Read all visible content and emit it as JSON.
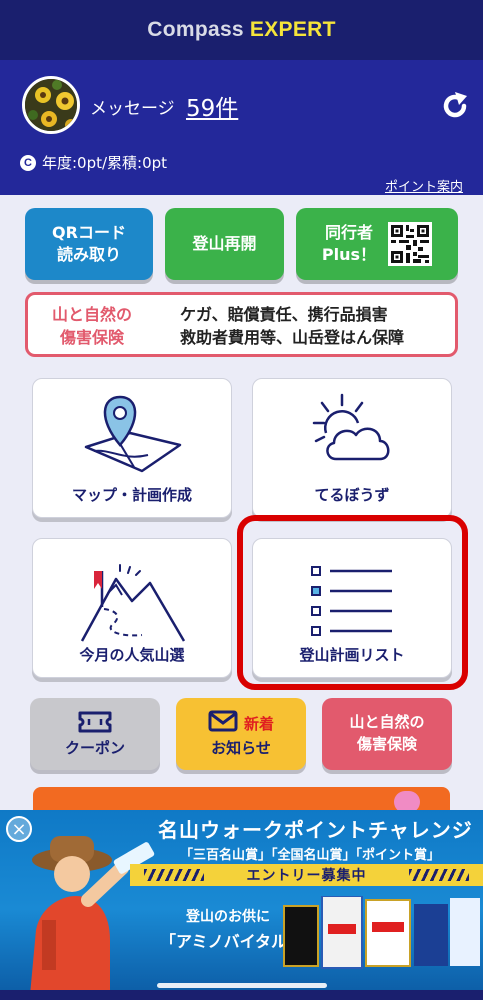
{
  "header": {
    "title_part1": "Compass",
    "title_part2": "EXPERT"
  },
  "profile": {
    "message_label": "メッセージ",
    "message_count": "59件",
    "points_text": "年度:0pt/累積:0pt",
    "points_icon_letter": "C",
    "point_guide_link": "ポイント案内"
  },
  "actions": {
    "qr_line1": "QRコード",
    "qr_line2": "読み取り",
    "resume": "登山再開",
    "companion_line1": "同行者",
    "companion_line2": "Plus！"
  },
  "insurance_banner": {
    "title_line1": "山と自然の",
    "title_line2": "傷害保険",
    "desc_line1": "ケガ、賠償責任、携行品損害",
    "desc_line2": "救助者費用等、山岳登はん保障"
  },
  "tiles": {
    "map": "マップ・計画作成",
    "weather": "てるぼうず",
    "popular": "今月の人気山選",
    "plan_list": "登山計画リスト"
  },
  "small_buttons": {
    "coupon": "クーポン",
    "news_new": "新着",
    "news": "お知らせ",
    "insurance_line1": "山と自然の",
    "insurance_line2": "傷害保険"
  },
  "ad": {
    "title": "名山ウォークポイントチャレンジ",
    "subtitle": "「三百名山賞」「全国名山賞」「ポイント賞」",
    "band": "エントリー募集中",
    "copy1": "登山のお供に",
    "copy2": "「アミノバイタル®」",
    "close": "×"
  },
  "colors": {
    "navy": "#1a1f6e",
    "profile_blue": "#23289a",
    "green": "#3bb24a",
    "blue": "#1d88c9",
    "red": "#e25a6d",
    "yellow": "#f7c133",
    "highlight": "#d90000"
  }
}
